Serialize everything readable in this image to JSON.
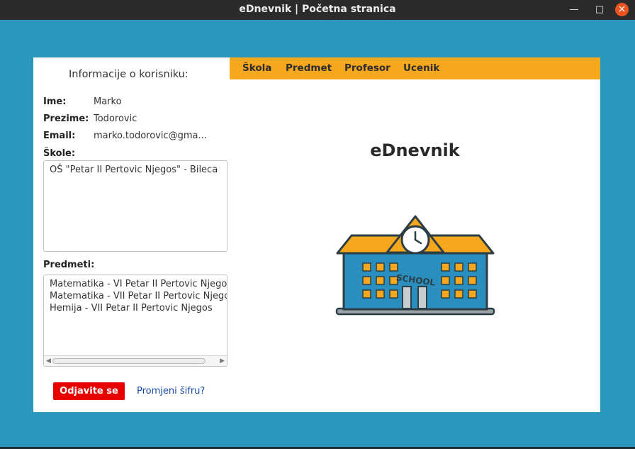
{
  "window": {
    "title": "eDnevnik | Početna stranica",
    "minimize_glyph": "—",
    "maximize_glyph": "□",
    "close_glyph": "×"
  },
  "user_info": {
    "heading": "Informacije o korisniku:",
    "name_label": "Ime:",
    "name_value": "Marko",
    "surname_label": "Prezime:",
    "surname_value": "Todorovic",
    "email_label": "Email:",
    "email_value": "marko.todorovic@gma..."
  },
  "schools": {
    "label": "Škole:",
    "items": [
      "OŠ \"Petar II Pertovic Njegos\" - Bileca"
    ]
  },
  "subjects": {
    "label": "Predmeti:",
    "items": [
      "Matematika - VI Petar II Pertovic Njegos",
      "Matematika - VII Petar II Pertovic Njegos",
      "Hemija - VII Petar II Pertovic Njegos"
    ]
  },
  "actions": {
    "logout_label": "Odjavite se",
    "change_password_label": "Promjeni šifru?"
  },
  "menu": {
    "items": [
      "Škola",
      "Predmet",
      "Profesor",
      "Ucenik"
    ]
  },
  "main": {
    "app_title": "eDnevnik",
    "illustration": "school-building-icon",
    "illustration_text": "SCHOOL"
  },
  "colors": {
    "background": "#2a97bf",
    "menu_bar": "#f5a71d",
    "logout_button": "#e80000",
    "link": "#1a4aa8"
  }
}
